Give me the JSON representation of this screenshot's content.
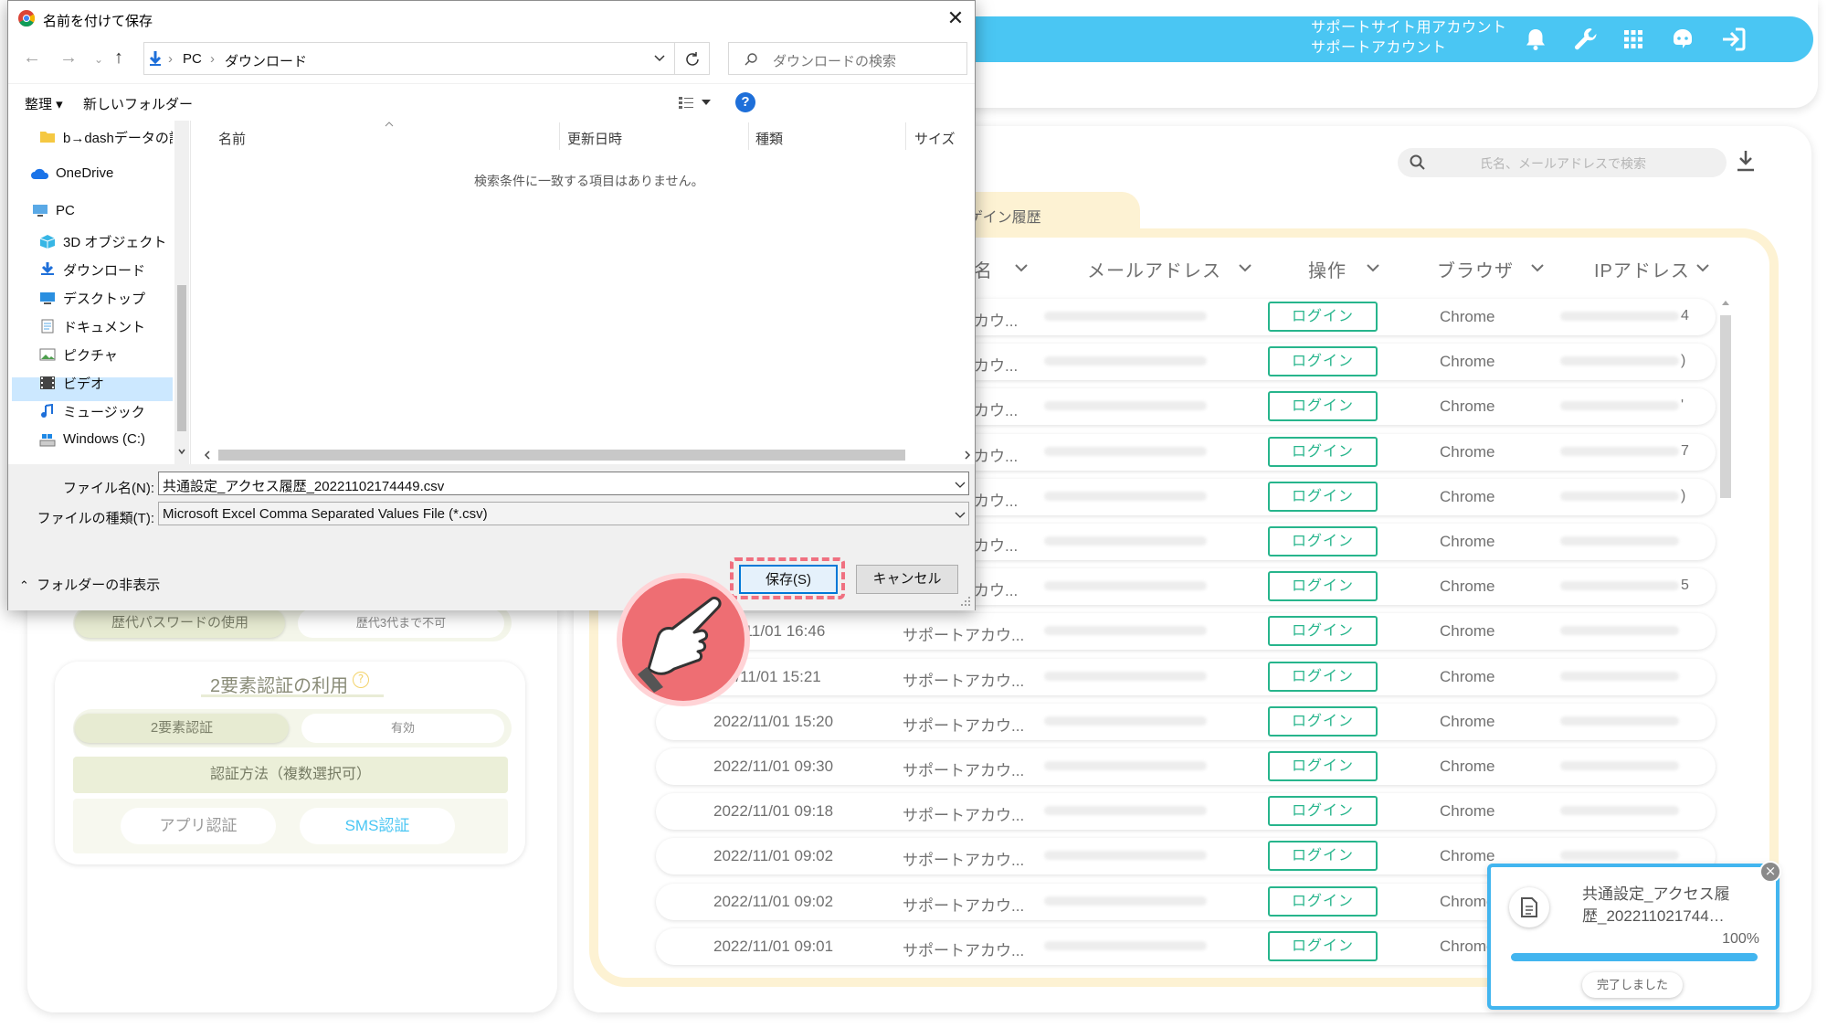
{
  "app": {
    "account_line1": "サポートサイト用アカウント",
    "account_line2": "サポートアカウント",
    "icons": [
      "bell-icon",
      "wrench-icon",
      "grid-icon",
      "support-icon",
      "logout-icon"
    ]
  },
  "log_panel": {
    "search_placeholder": "氏名、メールアドレスで検索",
    "tab_label": "ログイン履歴",
    "tab_visible": "ゲイン履歴",
    "columns": [
      "名",
      "メールアドレス",
      "操作",
      "ブラウザ",
      "IPアドレス"
    ],
    "rows": [
      {
        "date": "",
        "user": "カウ...",
        "action": "ログイン",
        "browser": "Chrome",
        "tail": "4"
      },
      {
        "date": "",
        "user": "カウ...",
        "action": "ログイン",
        "browser": "Chrome",
        "tail": ")"
      },
      {
        "date": "",
        "user": "カウ...",
        "action": "ログイン",
        "browser": "Chrome",
        "tail": "'"
      },
      {
        "date": "",
        "user": "カウ...",
        "action": "ログイン",
        "browser": "Chrome",
        "tail": "7"
      },
      {
        "date": "",
        "user": "カウ...",
        "action": "ログイン",
        "browser": "Chrome",
        "tail": ")"
      },
      {
        "date": "",
        "user": "カウ...",
        "action": "ログイン",
        "browser": "Chrome",
        "tail": ""
      },
      {
        "date": "",
        "user": "カウ...",
        "action": "ログイン",
        "browser": "Chrome",
        "tail": "5"
      },
      {
        "date": "/11/01 16:46",
        "user": "サポートアカウ...",
        "action": "ログイン",
        "browser": "Chrome",
        "tail": ""
      },
      {
        "date": "2/11/01 15:21",
        "user": "サポートアカウ...",
        "action": "ログイン",
        "browser": "Chrome",
        "tail": ""
      },
      {
        "date": "2022/11/01 15:20",
        "user": "サポートアカウ...",
        "action": "ログイン",
        "browser": "Chrome",
        "tail": ""
      },
      {
        "date": "2022/11/01 09:30",
        "user": "サポートアカウ...",
        "action": "ログイン",
        "browser": "Chrome",
        "tail": ""
      },
      {
        "date": "2022/11/01 09:18",
        "user": "サポートアカウ...",
        "action": "ログイン",
        "browser": "Chrome",
        "tail": ""
      },
      {
        "date": "2022/11/01 09:02",
        "user": "サポートアカウ...",
        "action": "ログイン",
        "browser": "Chrome",
        "tail": ""
      },
      {
        "date": "2022/11/01 09:02",
        "user": "サポートアカウ...",
        "action": "ログイン",
        "browser": "Chrome",
        "tail": ""
      },
      {
        "date": "2022/11/01 09:01",
        "user": "サポートアカウ...",
        "action": "ログイン",
        "browser": "Chrome",
        "tail": ""
      }
    ]
  },
  "settings": {
    "password_history_label": "歴代パスワードの使用",
    "password_history_value": "歴代3代まで不可",
    "twofa_title": "2要素認証の利用",
    "twofa_label": "2要素認証",
    "twofa_value": "有効",
    "method_label": "認証方法（複数選択可）",
    "method_app": "アプリ認証",
    "method_sms": "SMS認証"
  },
  "download_toast": {
    "filename_line1": "共通設定_アクセス履",
    "filename_line2": "歴_202211021744…",
    "percent": "100%",
    "progress": 1.0,
    "done_label": "完了しました"
  },
  "save_dialog": {
    "title": "名前を付けて保存",
    "breadcrumb": [
      "PC",
      "ダウンロード"
    ],
    "search_placeholder": "ダウンロードの検索",
    "toolbar_organize": "整理 ▾",
    "toolbar_new_folder": "新しいフォルダー",
    "nav_items": [
      "b→dashデータの詳",
      "OneDrive",
      "PC",
      "3D オブジェクト",
      "ダウンロード",
      "デスクトップ",
      "ドキュメント",
      "ピクチャ",
      "ビデオ",
      "ミュージック",
      "Windows (C:)"
    ],
    "columns": [
      "名前",
      "更新日時",
      "種類",
      "サイズ"
    ],
    "empty_message": "検索条件に一致する項目はありません。",
    "filename_label": "ファイル名(N):",
    "filename_value": "共通設定_アクセス履歴_20221102174449.csv",
    "filetype_label": "ファイルの種類(T):",
    "filetype_value": "Microsoft Excel Comma Separated Values File (*.csv)",
    "save_button": "保存(S)",
    "cancel_button": "キャンセル",
    "hide_folders": "フォルダーの非表示"
  },
  "colors": {
    "brand_blue": "#4ac6f3",
    "login_green": "#27b58c",
    "cream": "#fdf2d3",
    "highlight_pink": "#f07080",
    "dialog_accent": "#0078d7"
  }
}
